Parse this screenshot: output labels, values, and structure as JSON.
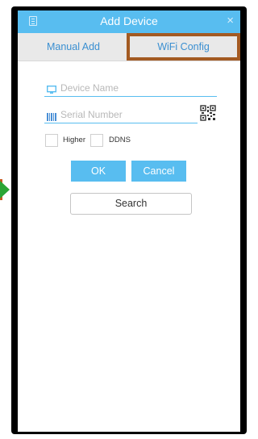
{
  "header": {
    "title": "Add Device",
    "menu_icon": "menu-list-icon",
    "close_symbol": "×"
  },
  "tabs": [
    {
      "label": "Manual Add"
    },
    {
      "label": "WiFi Config"
    }
  ],
  "form": {
    "device_name_placeholder": "Device Name",
    "serial_number_placeholder": "Serial Number",
    "qr_icon": "qr-code-icon",
    "checkboxes": [
      {
        "label": "Higher",
        "checked": false
      },
      {
        "label": "DDNS",
        "checked": false
      }
    ]
  },
  "buttons": {
    "ok": "OK",
    "cancel": "Cancel",
    "search": "Search"
  },
  "colors": {
    "accent": "#58bdf0",
    "highlight_border": "#a35a22",
    "tab_text": "#3a8fd1",
    "arrow": "#2aa535"
  }
}
